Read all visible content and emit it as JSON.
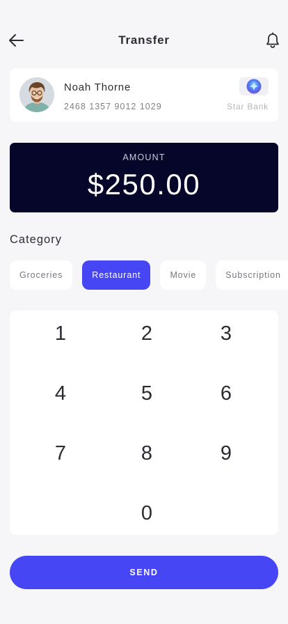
{
  "header": {
    "title": "Transfer",
    "back_icon": "arrow-left-icon",
    "bell_icon": "bell-icon"
  },
  "recipient": {
    "name": "Noah Thorne",
    "account_number": "2468 1357 9012 1029",
    "bank_name": "Star Bank",
    "bank_logo_icon": "bank-logo-icon"
  },
  "amount": {
    "label": "AMOUNT",
    "value": "$250.00"
  },
  "category": {
    "label": "Category",
    "items": [
      {
        "label": "Groceries",
        "active": false
      },
      {
        "label": "Restaurant",
        "active": true
      },
      {
        "label": "Movie",
        "active": false
      },
      {
        "label": "Subscription",
        "active": false
      }
    ]
  },
  "keypad": {
    "keys": [
      "1",
      "2",
      "3",
      "4",
      "5",
      "6",
      "7",
      "8",
      "9",
      "0"
    ]
  },
  "send_button": {
    "label": "SEND"
  },
  "colors": {
    "accent": "#4746f5",
    "amount_card": "#06062a",
    "background": "#f6f6f8"
  }
}
